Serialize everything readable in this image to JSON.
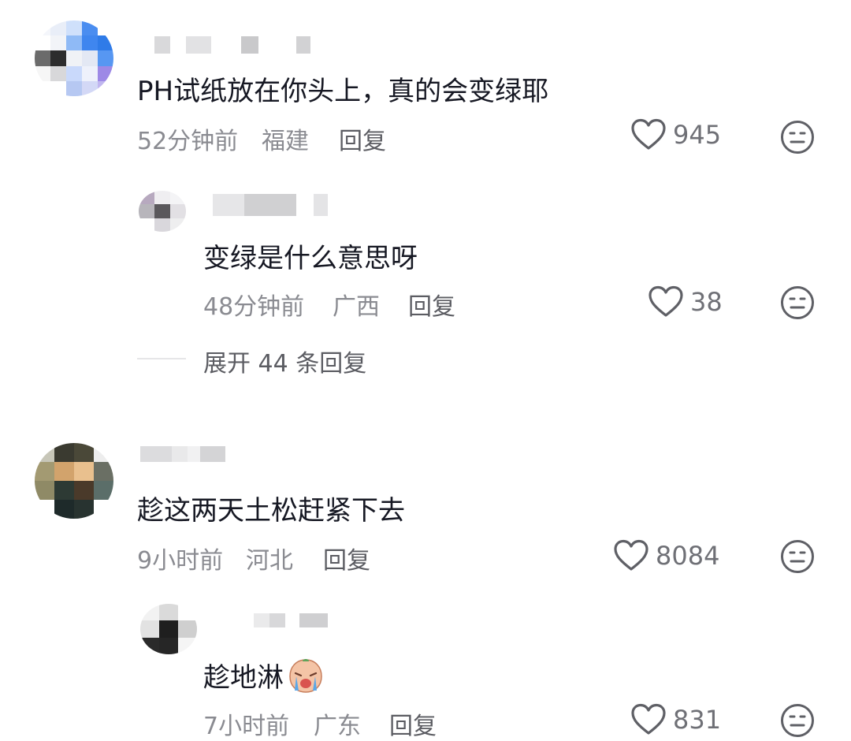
{
  "comments": [
    {
      "text": "PH试纸放在你头上，真的会变绿耶",
      "time": "52分钟前",
      "location": "福建",
      "reply_label": "回复",
      "likes": "945",
      "replies": [
        {
          "text": "变绿是什么意思呀",
          "time": "48分钟前",
          "location": "广西",
          "reply_label": "回复",
          "likes": "38"
        }
      ],
      "expand_label": "展开 44 条回复"
    },
    {
      "text": "趁这两天土松赶紧下去",
      "time": "9小时前",
      "location": "河北",
      "reply_label": "回复",
      "likes": "8084",
      "replies": [
        {
          "text": "趁地淋",
          "emoji_icon": "crying-face-emoji-icon",
          "time": "7小时前",
          "location": "广东",
          "reply_label": "回复",
          "likes": "831"
        }
      ]
    }
  ],
  "colors": {
    "text": "#161823",
    "meta": "#8a8b91",
    "icon": "#5f6066"
  },
  "icons": {
    "like": "heart-outline-icon",
    "dislike": "neutral-face-icon"
  }
}
